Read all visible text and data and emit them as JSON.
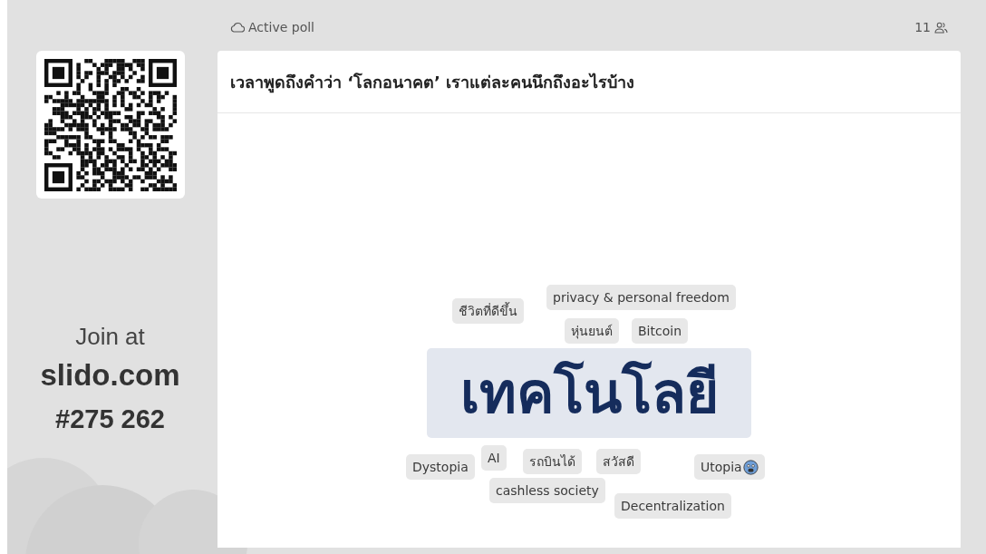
{
  "status": {
    "label": "Active poll",
    "participants": "11"
  },
  "join": {
    "prompt": "Join at",
    "site": "slido.com",
    "code": "#275 262"
  },
  "poll": {
    "question": "เวลาพูดถึงคำว่า ‘โลกอนาคต’ เราแต่ละคนนึกถึงอะไรบ้าง",
    "words": [
      {
        "text": "ชีวิตที่ดีขึ้น",
        "kind": "small"
      },
      {
        "text": "privacy & personal freedom",
        "kind": "small"
      },
      {
        "text": "หุ่นยนต์",
        "kind": "small"
      },
      {
        "text": "Bitcoin",
        "kind": "small"
      },
      {
        "text": "เทคโนโลยี",
        "kind": "top"
      },
      {
        "text": "Dystopia",
        "kind": "small"
      },
      {
        "text": "AI",
        "kind": "small"
      },
      {
        "text": "รถบินได้",
        "kind": "small"
      },
      {
        "text": "สวัสดี",
        "kind": "small"
      },
      {
        "text": "Utopia",
        "kind": "small_with_face"
      },
      {
        "text": "cashless society",
        "kind": "small"
      },
      {
        "text": "Decentralization",
        "kind": "small"
      }
    ]
  }
}
